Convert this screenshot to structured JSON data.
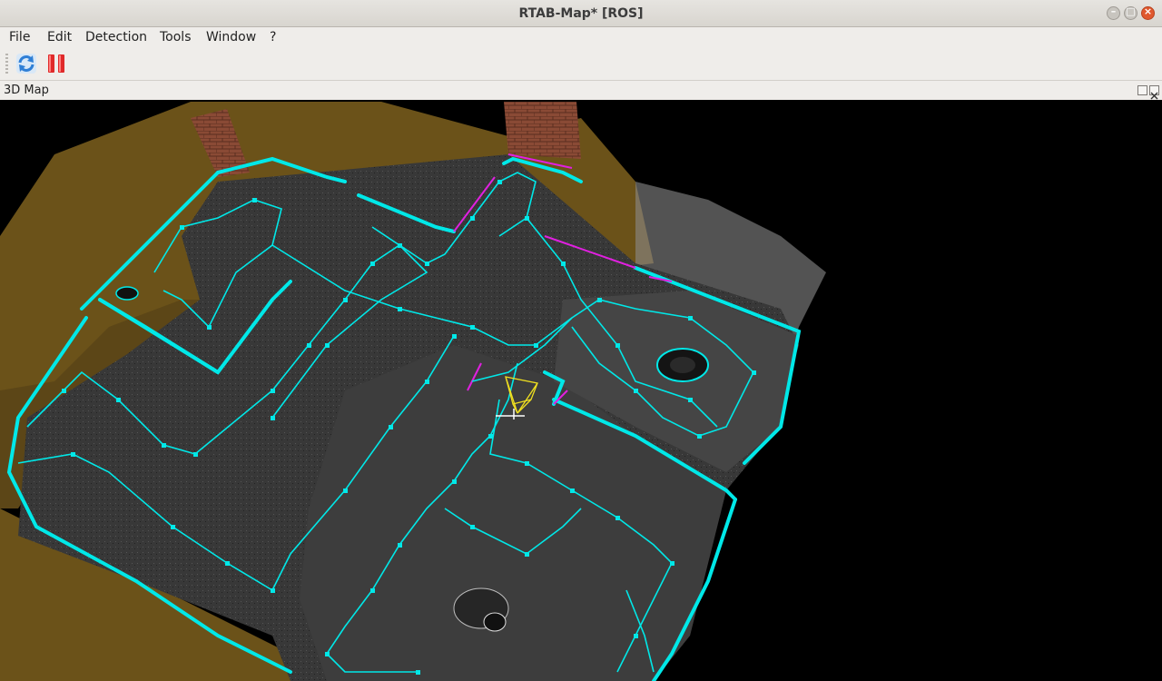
{
  "window": {
    "title": "RTAB-Map* [ROS]"
  },
  "menu": {
    "file": "File",
    "edit": "Edit",
    "detection": "Detection",
    "tools": "Tools",
    "window": "Window",
    "help": "?"
  },
  "toolbar": {
    "refresh_icon": "refresh-icon",
    "pause_icon": "pause-icon",
    "pause_color": "#e02a2a",
    "refresh_color": "#2f7fd6"
  },
  "dock": {
    "title": "3D Map"
  },
  "map": {
    "floor_color": "#3a3a3a",
    "wall_color": "#6b5219",
    "graph_color": "#00e8e8",
    "brick_color": "#8a4a35",
    "loop_closure_color": "#e020e0"
  }
}
